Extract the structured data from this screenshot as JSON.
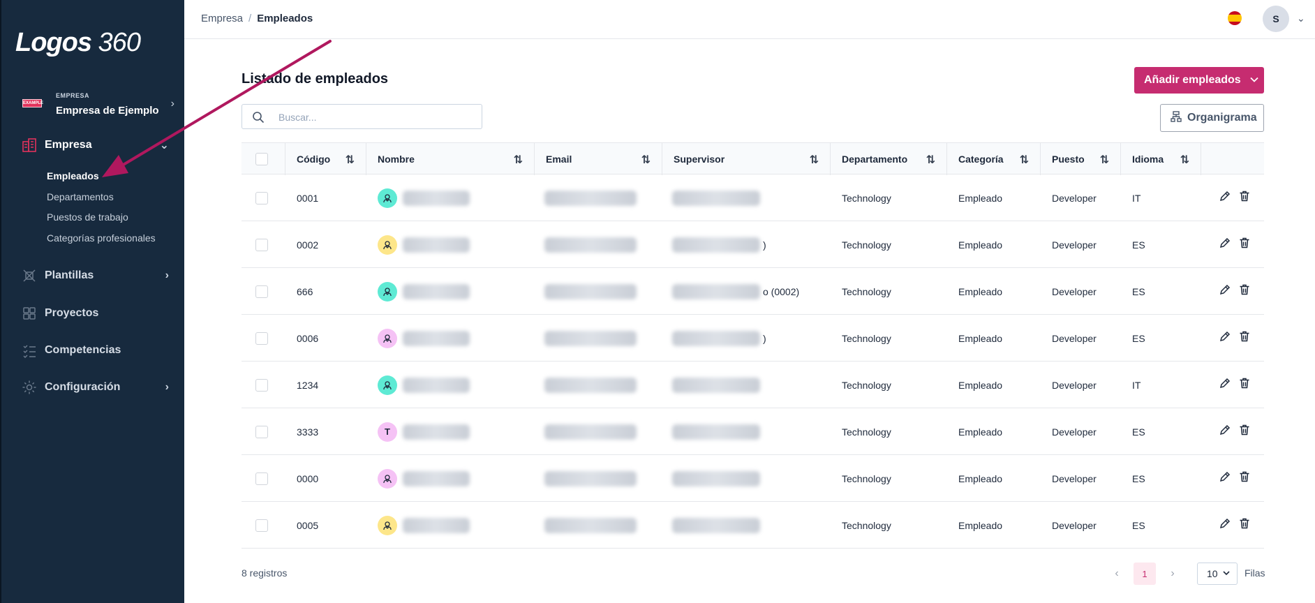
{
  "brand": {
    "logo_text": "Logos",
    "logo_number": "360"
  },
  "sidebar": {
    "company_badge": "EXAMPLE",
    "company_label": "EMPRESA",
    "company_name": "Empresa de Ejemplo",
    "items": [
      {
        "label": "Empresa",
        "icon": "building-icon"
      },
      {
        "label": "Plantillas",
        "icon": "template-icon"
      },
      {
        "label": "Proyectos",
        "icon": "grid-icon"
      },
      {
        "label": "Competencias",
        "icon": "list-check-icon"
      },
      {
        "label": "Configuración",
        "icon": "gear-icon"
      }
    ],
    "subitems": [
      {
        "label": "Empleados"
      },
      {
        "label": "Departamentos"
      },
      {
        "label": "Puestos de trabajo"
      },
      {
        "label": "Categorías profesionales"
      }
    ]
  },
  "topbar": {
    "breadcrumb": [
      "Empresa",
      "Empleados"
    ],
    "separator": "/",
    "user_initial": "S"
  },
  "main": {
    "title": "Listado de empleados",
    "add_button": "Añadir empleados",
    "org_button": "Organigrama",
    "search_placeholder": "Buscar..."
  },
  "table": {
    "columns": [
      "Código",
      "Nombre",
      "Email",
      "Supervisor",
      "Departamento",
      "Categoría",
      "Puesto",
      "Idioma"
    ],
    "rows": [
      {
        "code": "0001",
        "avatar": "person",
        "avatar_color": "#5eead4",
        "supervisor_tail": "",
        "department": "Technology",
        "category": "Empleado",
        "position": "Developer",
        "language": "IT"
      },
      {
        "code": "0002",
        "avatar": "person",
        "avatar_color": "#fde68a",
        "supervisor_tail": ")",
        "department": "Technology",
        "category": "Empleado",
        "position": "Developer",
        "language": "ES"
      },
      {
        "code": "666",
        "avatar": "person",
        "avatar_color": "#5eead4",
        "supervisor_tail": "o (0002)",
        "department": "Technology",
        "category": "Empleado",
        "position": "Developer",
        "language": "ES"
      },
      {
        "code": "0006",
        "avatar": "person",
        "avatar_color": "#f5c2f5",
        "supervisor_tail": ")",
        "department": "Technology",
        "category": "Empleado",
        "position": "Developer",
        "language": "ES"
      },
      {
        "code": "1234",
        "avatar": "person",
        "avatar_color": "#5eead4",
        "supervisor_tail": "",
        "department": "Technology",
        "category": "Empleado",
        "position": "Developer",
        "language": "IT"
      },
      {
        "code": "3333",
        "avatar": "T",
        "avatar_color": "#f5c2f5",
        "supervisor_tail": "",
        "department": "Technology",
        "category": "Empleado",
        "position": "Developer",
        "language": "ES"
      },
      {
        "code": "0000",
        "avatar": "person",
        "avatar_color": "#f5c2f5",
        "supervisor_tail": "",
        "department": "Technology",
        "category": "Empleado",
        "position": "Developer",
        "language": "ES"
      },
      {
        "code": "0005",
        "avatar": "person",
        "avatar_color": "#fde68a",
        "supervisor_tail": "",
        "department": "Technology",
        "category": "Empleado",
        "position": "Developer",
        "language": "ES"
      }
    ]
  },
  "footer": {
    "records": "8 registros",
    "current_page": "1",
    "rows_per_page": "10",
    "rows_label": "Filas"
  },
  "colors": {
    "accent": "#c62c70",
    "sidebar_bg": "#172a3e",
    "annotation_arrow": "#b0185e"
  }
}
